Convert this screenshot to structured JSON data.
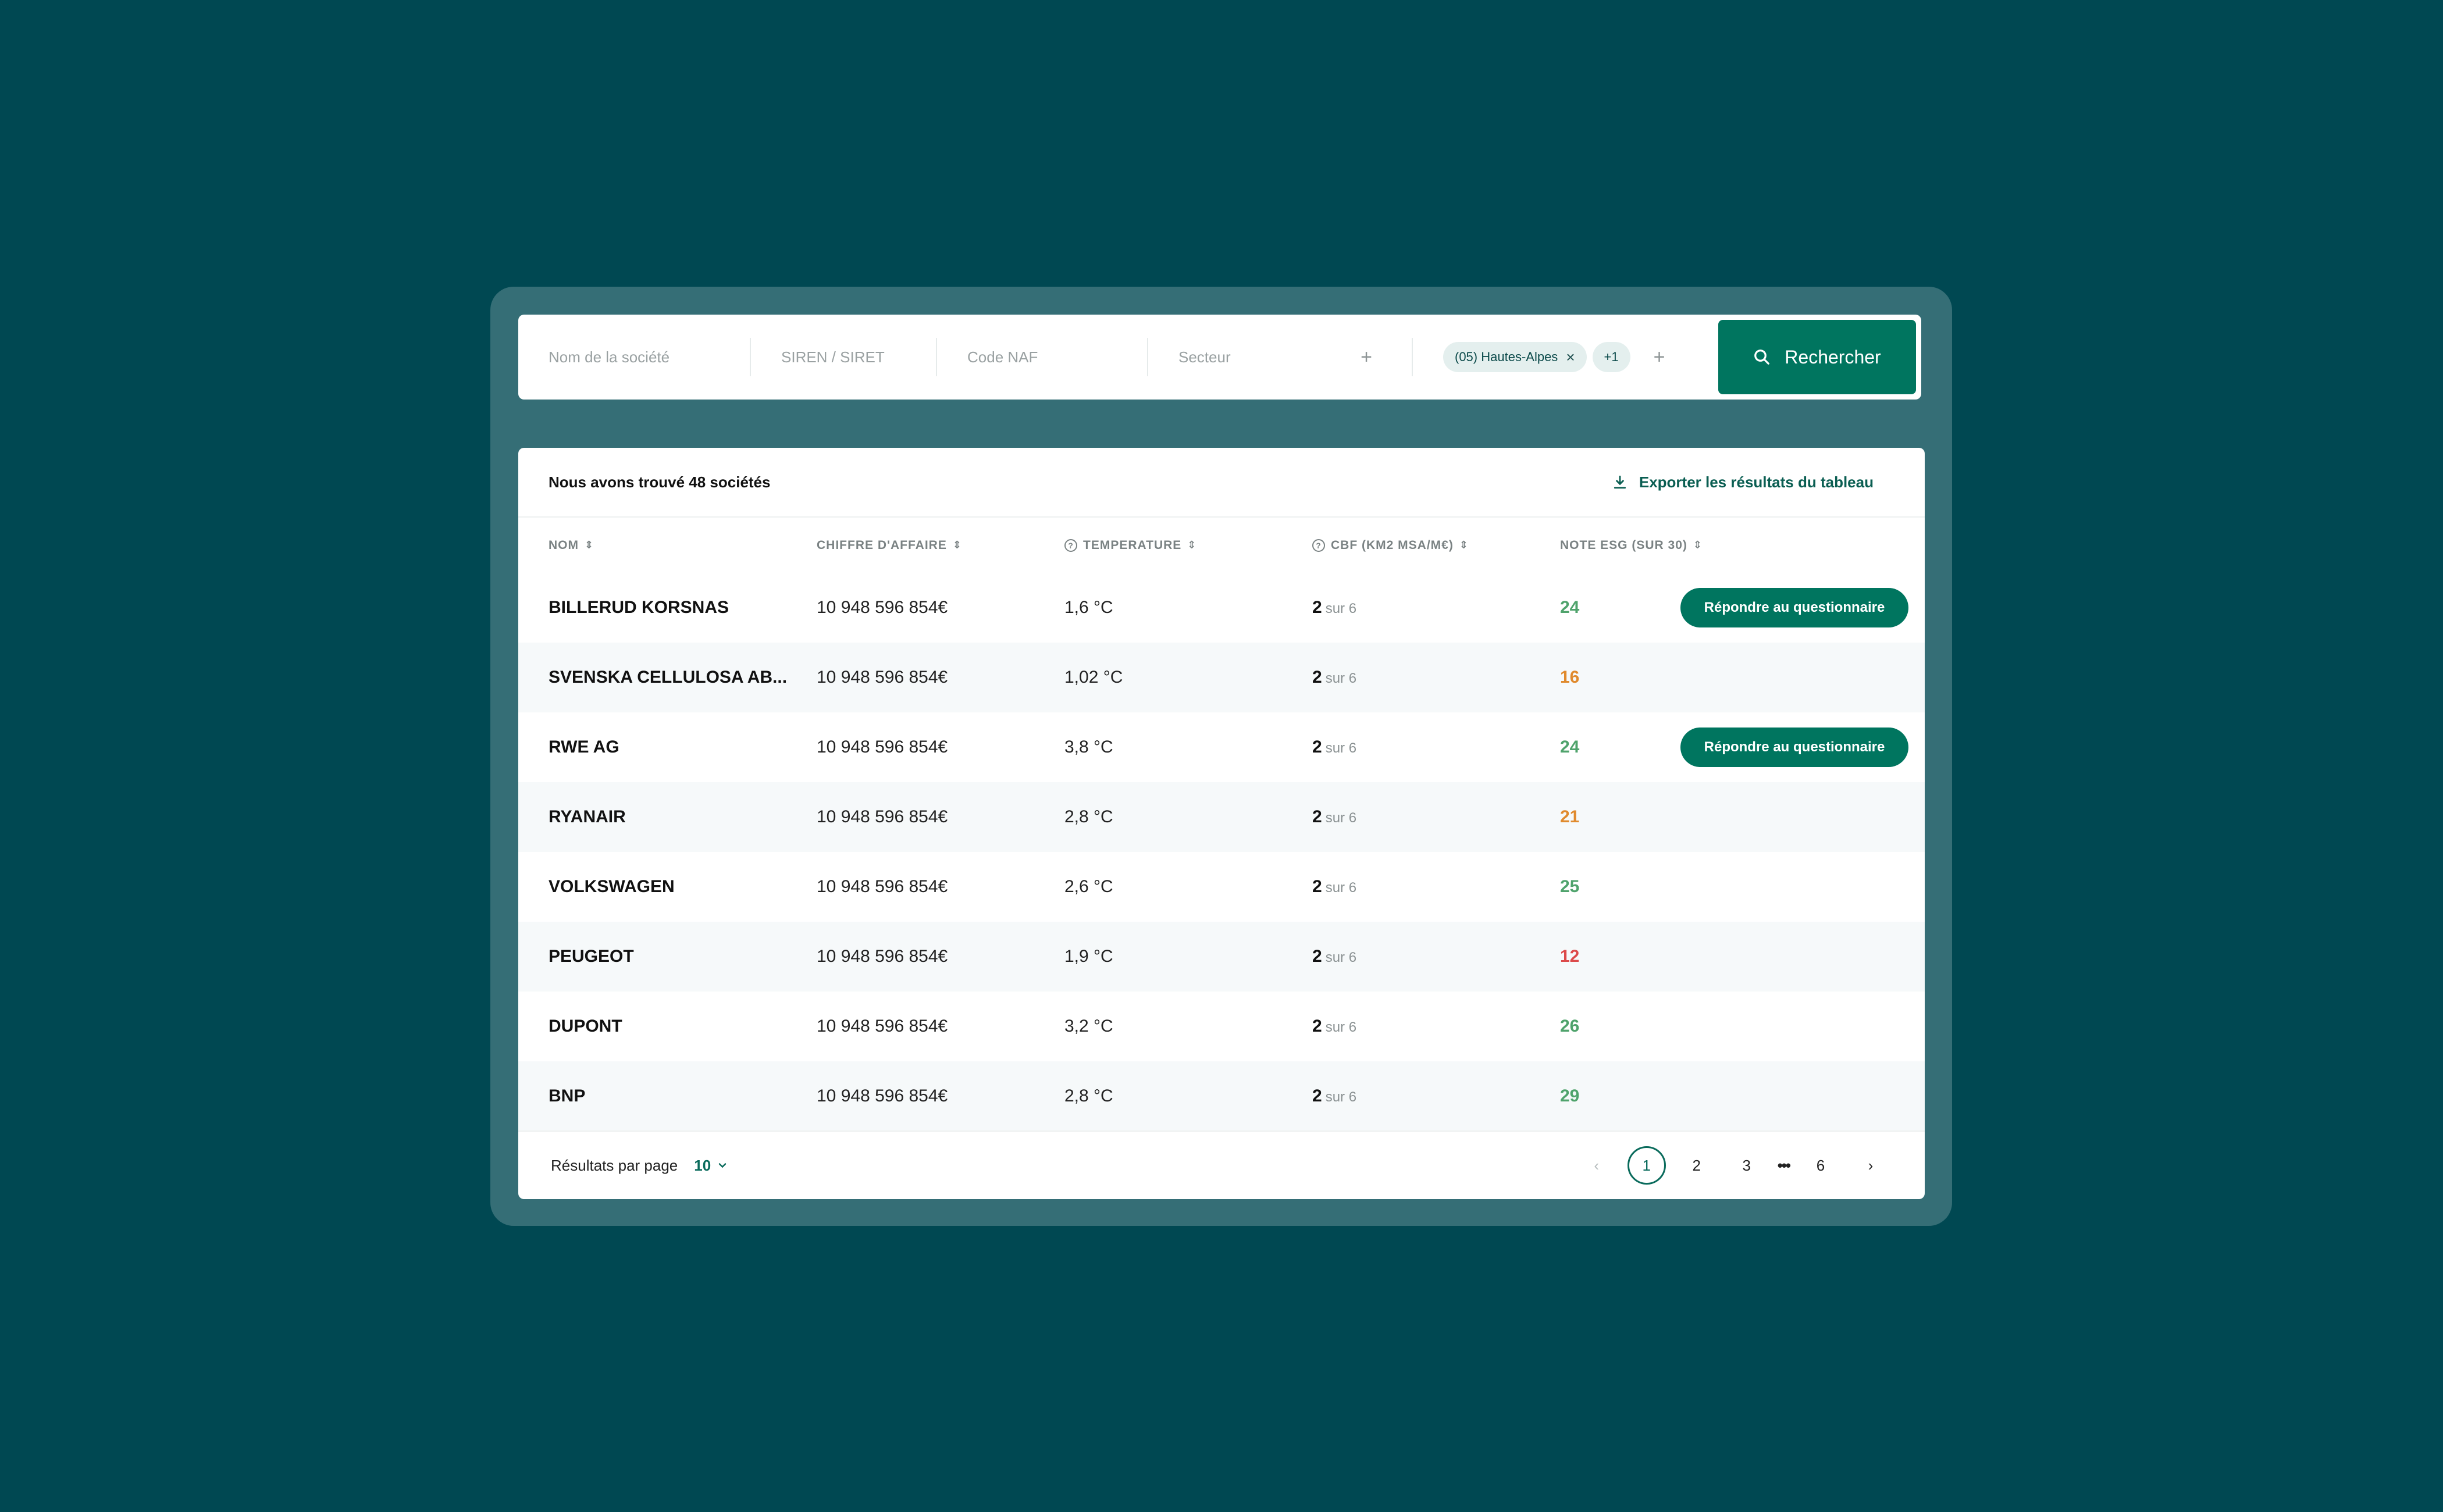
{
  "search": {
    "company_placeholder": "Nom de la société",
    "siren_placeholder": "SIREN / SIRET",
    "naf_placeholder": "Code NAF",
    "sector_placeholder": "Secteur",
    "plus_symbol": "+",
    "region_chip": "(05) Hautes-Alpes",
    "region_chip_close": "×",
    "extra_chip": "+1",
    "button_label": "Rechercher"
  },
  "results": {
    "found_text": "Nous avons trouvé 48 sociétés",
    "export_label": "Exporter les résultats du tableau"
  },
  "table": {
    "headers": {
      "nom": "NOM",
      "ca": "CHIFFRE D'AFFAIRE",
      "temp": "TEMPERATURE",
      "cbf": "CBF (KM2 MSA/M€)",
      "note": "NOTE ESG (SUR 30)"
    },
    "sort_icon": "⇕",
    "help_icon": "?",
    "cbf_suffix": "sur 6",
    "action_label": "Répondre au questionnaire",
    "rows": [
      {
        "nom": "BILLERUD KORSNAS",
        "ca": "10 948 596 854€",
        "temp": "1,6 °C",
        "cbf": "2",
        "note": "24"
      },
      {
        "nom": "SVENSKA CELLULOSA AB...",
        "ca": "10 948 596 854€",
        "temp": "1,02 °C",
        "cbf": "2",
        "note": "16"
      },
      {
        "nom": "RWE AG",
        "ca": "10 948 596 854€",
        "temp": "3,8 °C",
        "cbf": "2",
        "note": "24"
      },
      {
        "nom": "RYANAIR",
        "ca": "10 948 596 854€",
        "temp": "2,8 °C",
        "cbf": "2",
        "note": "21"
      },
      {
        "nom": "VOLKSWAGEN",
        "ca": "10 948 596 854€",
        "temp": "2,6 °C",
        "cbf": "2",
        "note": "25"
      },
      {
        "nom": "PEUGEOT",
        "ca": "10 948 596 854€",
        "temp": "1,9 °C",
        "cbf": "2",
        "note": "12"
      },
      {
        "nom": "DUPONT",
        "ca": "10 948 596 854€",
        "temp": "3,2 °C",
        "cbf": "2",
        "note": "26"
      },
      {
        "nom": "BNP",
        "ca": "10 948 596 854€",
        "temp": "2,8 °C",
        "cbf": "2",
        "note": "29"
      }
    ]
  },
  "colors": {
    "background": "#004852",
    "frame": "#356e76",
    "primary": "#00755f",
    "note_green": "#4fa36c",
    "note_orange": "#e08a2d",
    "note_red": "#dc4a4a"
  },
  "footer": {
    "per_page_label": "Résultats par page",
    "per_page_value": "10",
    "pages": [
      "1",
      "2",
      "3",
      "6"
    ],
    "ellipsis": "•••",
    "prev": "‹",
    "next": "›"
  }
}
